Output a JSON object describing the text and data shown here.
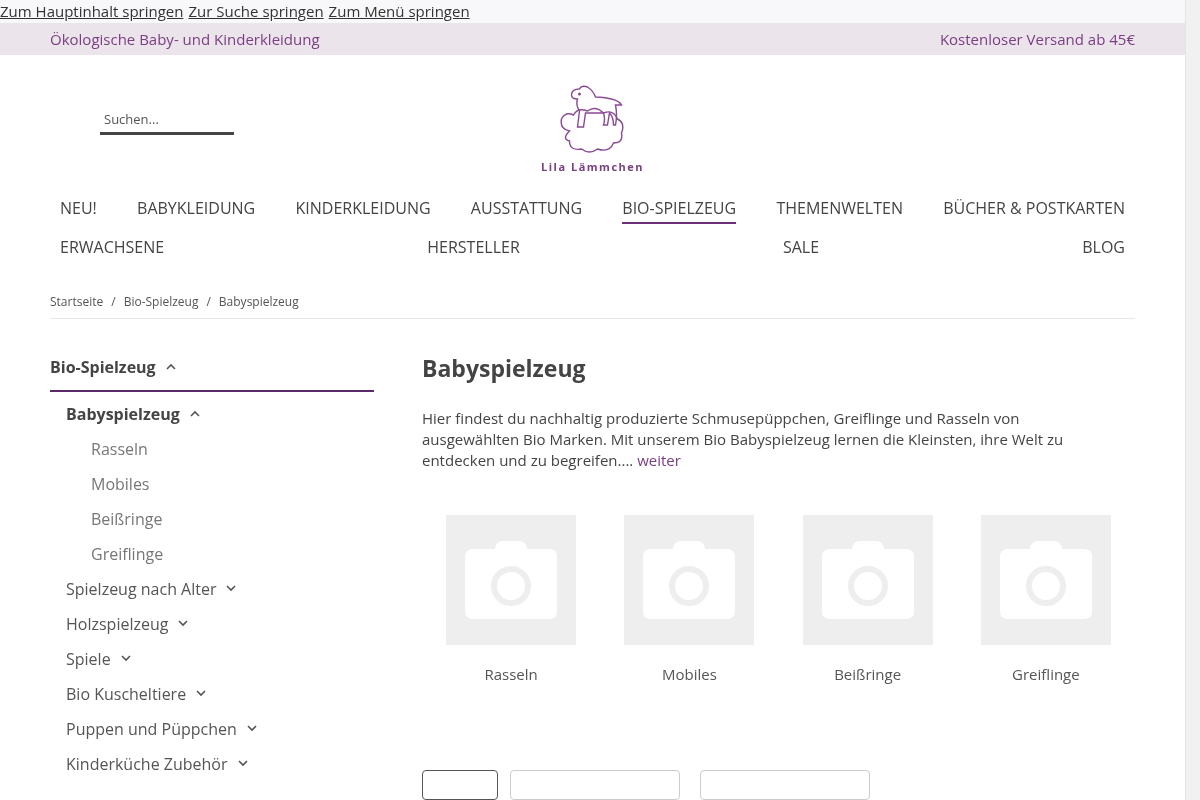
{
  "skip_links": [
    "Zum Hauptinhalt springen",
    "Zur Suche springen",
    "Zum Menü springen"
  ],
  "top_bar": {
    "left": "Ökologische Baby- und Kinderkleidung",
    "right": "Kostenloser Versand ab 45€"
  },
  "search": {
    "placeholder": "Suchen..."
  },
  "logo": {
    "text": "Lila Lämmchen"
  },
  "nav_rows": [
    [
      {
        "label": "NEU!",
        "selected": false
      },
      {
        "label": "BABYKLEIDUNG",
        "selected": false
      },
      {
        "label": "KINDERKLEIDUNG",
        "selected": false
      },
      {
        "label": "AUSSTATTUNG",
        "selected": false
      },
      {
        "label": "BIO-SPIELZEUG",
        "selected": true
      },
      {
        "label": "THEMENWELTEN",
        "selected": false
      },
      {
        "label": "BÜCHER & POSTKARTEN",
        "selected": false
      }
    ],
    [
      {
        "label": "ERWACHSENE",
        "selected": false
      },
      {
        "label": "HERSTELLER",
        "selected": false
      },
      {
        "label": "SALE",
        "selected": false
      },
      {
        "label": "BLOG",
        "selected": false
      }
    ]
  ],
  "breadcrumb": [
    "Startseite",
    "Bio-Spielzeug",
    "Babyspielzeug"
  ],
  "breadcrumb_separator": "/",
  "sidebar": [
    {
      "label": "Bio-Spielzeug",
      "expanded": true,
      "children": [
        {
          "label": "Babyspielzeug",
          "expanded": true,
          "selected": true,
          "children": [
            {
              "label": "Rasseln"
            },
            {
              "label": "Mobiles"
            },
            {
              "label": "Beißringe"
            },
            {
              "label": "Greiflinge"
            }
          ]
        },
        {
          "label": "Spielzeug nach Alter",
          "expanded": false,
          "selected": false
        },
        {
          "label": "Holzspielzeug",
          "expanded": false,
          "selected": false
        },
        {
          "label": "Spiele",
          "expanded": false,
          "selected": false
        },
        {
          "label": "Bio Kuscheltiere",
          "expanded": false,
          "selected": false
        },
        {
          "label": "Puppen und Püppchen",
          "expanded": false,
          "selected": false
        },
        {
          "label": "Kinderküche Zubehör",
          "expanded": false,
          "selected": false
        }
      ]
    }
  ],
  "heading": "Babyspielzeug",
  "description": "Hier findest du nachhaltig produzierte Schmusepüppchen, Greiflinge und Rasseln von ausgewählten Bio Marken. Mit unserem Bio Babyspielzeug lernen die Kleinsten, ihre Welt zu entdecken und zu begreifen....",
  "more_link": "weiter",
  "categories": [
    {
      "label": "Rasseln"
    },
    {
      "label": "Mobiles"
    },
    {
      "label": "Beißringe"
    },
    {
      "label": "Greiflinge"
    }
  ]
}
